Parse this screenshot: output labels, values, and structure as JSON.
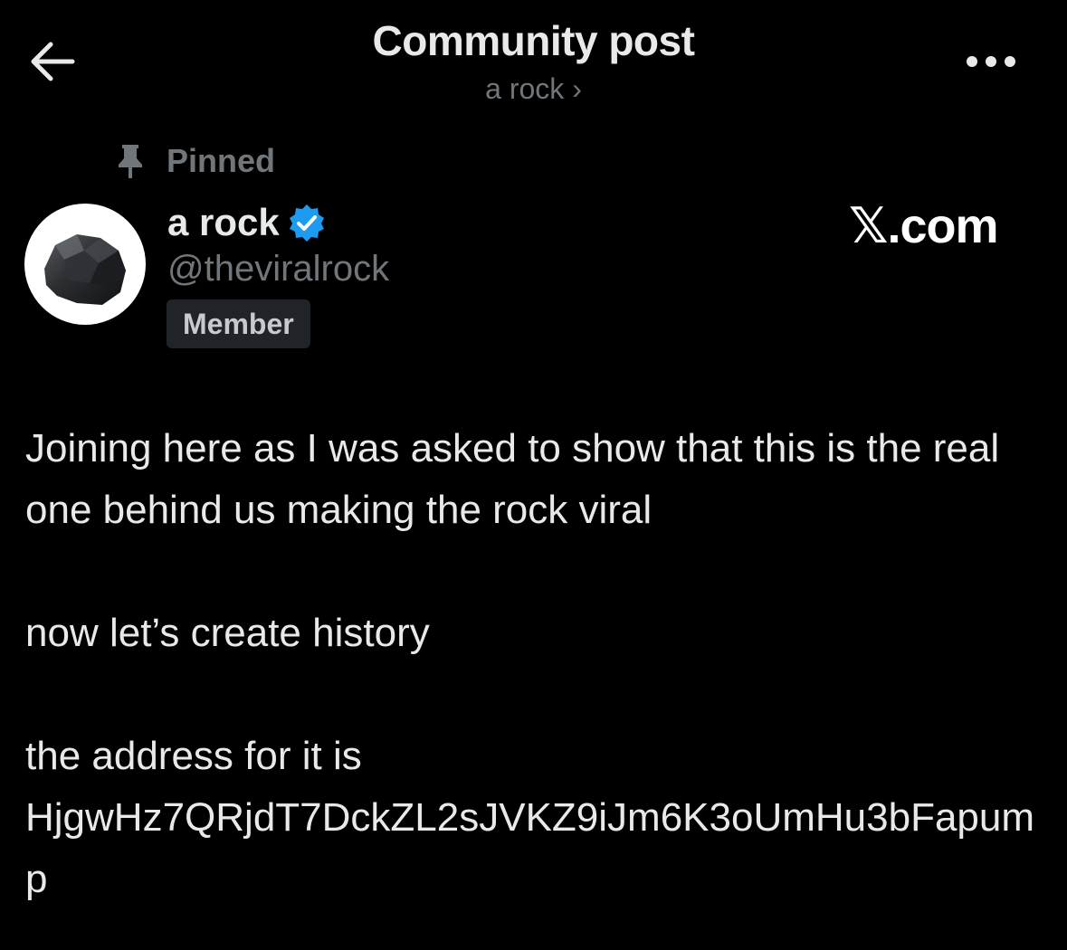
{
  "header": {
    "title": "Community post",
    "community_link": "a rock ›",
    "back_icon": "arrow-left-icon",
    "more_icon": "ellipsis-icon"
  },
  "post": {
    "pinned_label": "Pinned",
    "author": {
      "name": "a rock",
      "handle": "@theviralrock",
      "role_badge": "Member",
      "verified": true,
      "verified_color": "#1d9bf0"
    },
    "watermark": "𝕏.com",
    "body": {
      "line1": "Joining here as I was asked to show that this is the real one behind us making the rock viral",
      "line2": "now let’s create history",
      "line3": "the address for it is HjgwHz7QRjdT7DckZL2sJVKZ9iJm6K3oUmHu3bFapump"
    }
  },
  "colors": {
    "background": "#000000",
    "primary_text": "#e7e9ea",
    "secondary_text": "#71767b",
    "badge_bg": "#202327"
  }
}
